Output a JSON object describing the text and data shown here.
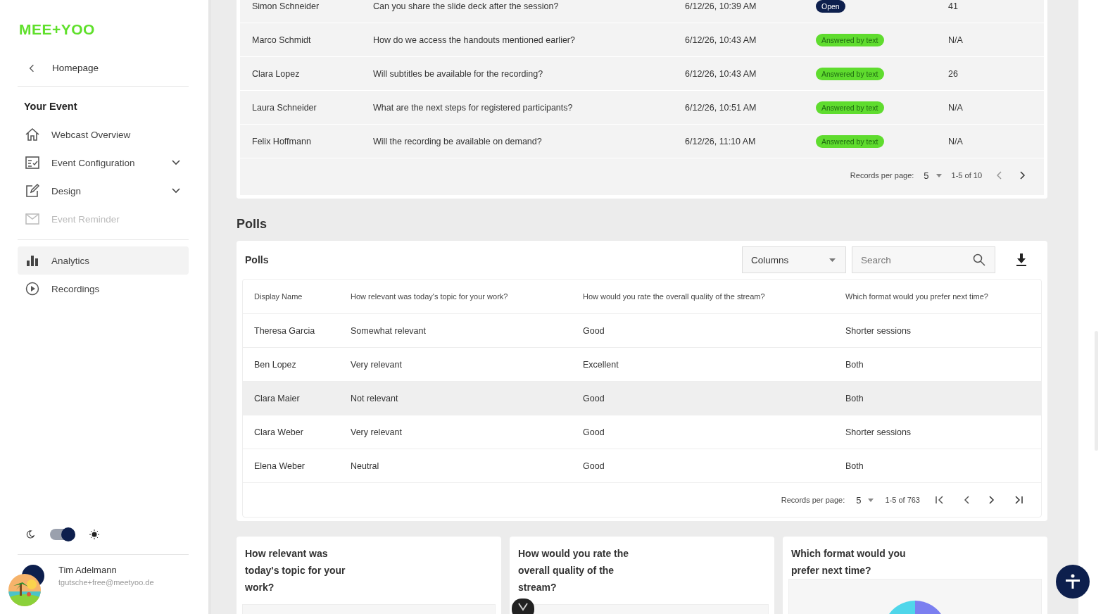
{
  "sidebar": {
    "logo": "MEE+YOO",
    "back": {
      "label": "Homepage"
    },
    "section_title": "Your Event",
    "items": [
      {
        "label": "Webcast Overview",
        "expandable": false,
        "disabled": false,
        "selected": false
      },
      {
        "label": "Event Configuration",
        "expandable": true,
        "disabled": false,
        "selected": false
      },
      {
        "label": "Design",
        "expandable": true,
        "disabled": false,
        "selected": false
      },
      {
        "label": "Event Reminder",
        "expandable": false,
        "disabled": true,
        "selected": false
      },
      {
        "label": "Analytics",
        "expandable": false,
        "disabled": false,
        "selected": true
      },
      {
        "label": "Recordings",
        "expandable": false,
        "disabled": false,
        "selected": false
      }
    ],
    "theme_toggle": {
      "on": true
    },
    "user": {
      "name": "Tim Adelmann",
      "email": "tgutsche+free@meetyoo.de"
    }
  },
  "questions": {
    "rows": [
      {
        "name": "Simon Schneider",
        "question": "Can you share the slide deck after the session?",
        "time": "6/12/26, 10:39 AM",
        "status": {
          "kind": "open",
          "label": "Open"
        },
        "column_5": "41"
      },
      {
        "name": "Marco Schmidt",
        "question": "How do we access the handouts mentioned earlier?",
        "time": "6/12/26, 10:43 AM",
        "status": {
          "kind": "answered",
          "label": "Answered by text"
        },
        "column_5": "N/A"
      },
      {
        "name": "Clara Lopez",
        "question": "Will subtitles be available for the recording?",
        "time": "6/12/26, 10:43 AM",
        "status": {
          "kind": "answered",
          "label": "Answered by text"
        },
        "column_5": "26"
      },
      {
        "name": "Laura Schneider",
        "question": "What are the next steps for registered participants?",
        "time": "6/12/26, 10:51 AM",
        "status": {
          "kind": "answered",
          "label": "Answered by text"
        },
        "column_5": "N/A"
      },
      {
        "name": "Felix Hoffmann",
        "question": "Will the recording be available on demand?",
        "time": "6/12/26, 11:10 AM",
        "status": {
          "kind": "answered",
          "label": "Answered by text"
        },
        "column_5": "N/A"
      }
    ],
    "pagination": {
      "label": "Records per page:",
      "per_page": "5",
      "range": "1-5 of 10"
    }
  },
  "polls": {
    "heading": "Polls",
    "card_title": "Polls",
    "columns_dropdown": "Columns",
    "search": {
      "placeholder": "Search"
    },
    "columns": [
      "Display Name",
      "How relevant was today's topic for your work?",
      "How would you rate the overall quality of the stream?",
      "Which format would you prefer next time?"
    ],
    "rows": [
      {
        "cells": [
          "Theresa Garcia",
          "Somewhat relevant",
          "Good",
          "Shorter sessions"
        ],
        "hovered": false
      },
      {
        "cells": [
          "Ben Lopez",
          "Very relevant",
          "Excellent",
          "Both"
        ],
        "hovered": false
      },
      {
        "cells": [
          "Clara Maier",
          "Not relevant",
          "Good",
          "Both"
        ],
        "hovered": true
      },
      {
        "cells": [
          "Clara Weber",
          "Very relevant",
          "Good",
          "Shorter sessions"
        ],
        "hovered": false
      },
      {
        "cells": [
          "Elena Weber",
          "Neutral",
          "Good",
          "Both"
        ],
        "hovered": false
      }
    ],
    "pagination": {
      "label": "Records per page:",
      "per_page": "5",
      "range": "1-5 of 763"
    }
  },
  "chart_cards": [
    {
      "title": "How relevant was today's topic for your work?",
      "kind": "empty"
    },
    {
      "title": "How would you rate the overall quality of the stream?",
      "kind": "empty"
    },
    {
      "title": "Which format would you prefer next time?",
      "kind": "pie"
    }
  ]
}
